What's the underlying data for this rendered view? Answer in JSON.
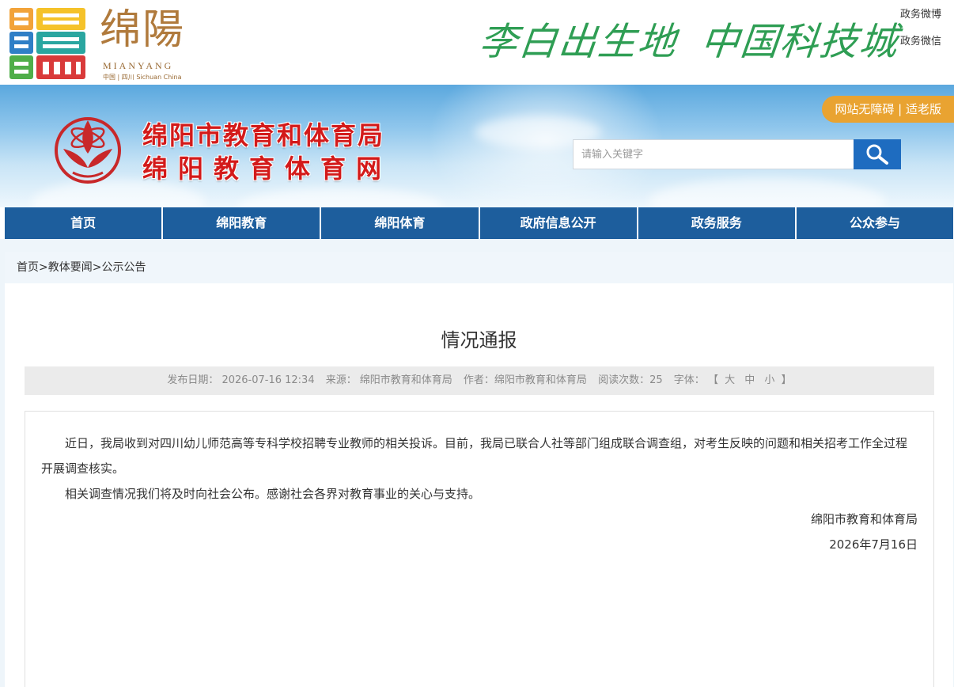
{
  "header": {
    "city_name_cn": "绵陽",
    "city_name_en": "MIANYANG",
    "city_sub": "中国 | 四川 Sichuan China",
    "slogan_1": "李白出生地",
    "slogan_2": "中国科技城",
    "social_links": [
      "政务微博",
      "政务微信"
    ]
  },
  "banner": {
    "title_line1": "绵阳市教育和体育局",
    "title_line2": "绵阳教育体育网",
    "access_button": "网站无障碍 | 适老版",
    "search_placeholder": "请输入关键字"
  },
  "nav": {
    "items": [
      "首页",
      "绵阳教育",
      "绵阳体育",
      "政府信息公开",
      "政务服务",
      "公众参与"
    ]
  },
  "breadcrumb": {
    "items": [
      "首页",
      "教体要闻",
      "公示公告"
    ],
    "separator": ">"
  },
  "article": {
    "title": "情况通报",
    "meta": {
      "date_label": "发布日期：",
      "date_value": "2026-07-16 12:34",
      "source_label": "来源：",
      "source_value": "绵阳市教育和体育局",
      "author_label": "作者：",
      "author_value": "绵阳市教育和体育局",
      "views_label": "阅读次数：",
      "views_value": "25",
      "fontsize_label": "字体：",
      "fontsize_open": "【",
      "fontsize_options": [
        "大",
        "中",
        "小"
      ],
      "fontsize_close": "】"
    },
    "paragraphs": [
      "近日，我局收到对四川幼儿师范高等专科学校招聘专业教师的相关投诉。目前，我局已联合人社等部门组成联合调查组，对考生反映的问题和相关招考工作全过程开展调查核实。",
      "相关调查情况我们将及时向社会公布。感谢社会各界对教育事业的关心与支持。"
    ],
    "signature_org": "绵阳市教育和体育局",
    "signature_date": "2026年7月16日"
  },
  "colors": {
    "nav_bg": "#1d5e9d",
    "title_red": "#d31a1a",
    "search_button": "#1e6cc0",
    "access_orange": "#e9a331",
    "slogan_green": "#2f9e54"
  }
}
